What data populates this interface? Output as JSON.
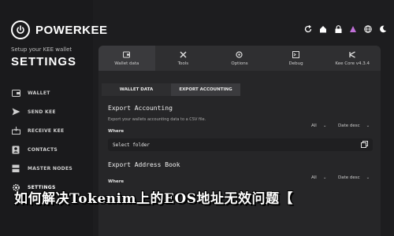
{
  "brand": {
    "name": "POWERKEE"
  },
  "sidebar": {
    "subtitle": "Setup your KEE wallet",
    "heading": "SETTINGS",
    "items": [
      {
        "label": "WALLET",
        "icon": "wallet-icon"
      },
      {
        "label": "SEND KEE",
        "icon": "send-icon"
      },
      {
        "label": "RECEIVE KEE",
        "icon": "receive-icon"
      },
      {
        "label": "CONTACTS",
        "icon": "contacts-icon"
      },
      {
        "label": "MASTER NODES",
        "icon": "master-nodes-icon"
      },
      {
        "label": "SETTINGS",
        "icon": "gear-icon"
      }
    ]
  },
  "topbar": {
    "icons": [
      "refresh-icon",
      "home-icon",
      "lock-icon",
      "network-icon",
      "globe-icon",
      "moon-icon"
    ]
  },
  "tabs": [
    {
      "label": "Wallet data",
      "icon": "wallet-data-icon"
    },
    {
      "label": "Tools",
      "icon": "tools-icon"
    },
    {
      "label": "Options",
      "icon": "options-icon"
    },
    {
      "label": "Debug",
      "icon": "debug-icon"
    },
    {
      "label": "Kee Core v4.3.4",
      "icon": "kee-core-icon"
    }
  ],
  "subtabs": [
    {
      "label": "WALLET DATA"
    },
    {
      "label": "EXPORT ACCOUNTING"
    }
  ],
  "export_accounting": {
    "title": "Export Accounting",
    "description": "Export your wallets accounting data to a CSV file.",
    "where_label": "Where",
    "filter_value": "All",
    "sort_value": "Date desc",
    "select_label": "Select folder"
  },
  "export_address_book": {
    "title": "Export Address Book",
    "where_label": "Where",
    "filter_value": "All",
    "sort_value": "Date desc"
  },
  "overlay_caption": "如何解决Tokenim上的EOS地址无效问题【"
}
